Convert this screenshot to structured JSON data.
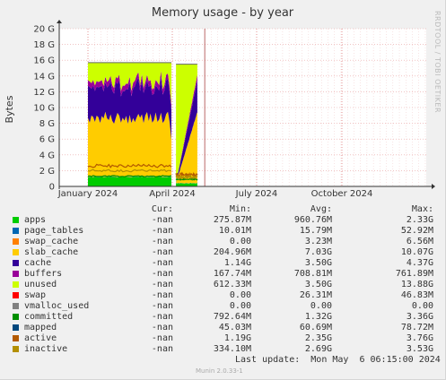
{
  "chart_data": {
    "type": "area",
    "title": "Memory usage - by year",
    "ylabel": "Bytes",
    "side_label": "RRDTOOL / TOBI OETIKER",
    "ylim": [
      0,
      20
    ],
    "y_ticks": [
      "0",
      "2 G",
      "4 G",
      "6 G",
      "8 G",
      "10 G",
      "12 G",
      "14 G",
      "16 G",
      "18 G",
      "20 G"
    ],
    "x_ticks": [
      "January 2024",
      "April 2024",
      "July 2024",
      "October 2024"
    ],
    "x_tick_months": [
      0,
      3,
      6,
      9
    ],
    "xlim": [
      "2023-12-01",
      "2024-12-31"
    ],
    "columns": {
      "cur": "Cur:",
      "min": "Min:",
      "avg": "Avg:",
      "max": "Max:"
    },
    "series": [
      {
        "name": "apps",
        "color": "#00cc00",
        "cur": "-nan",
        "min": "275.87M",
        "avg": "960.76M",
        "max": "2.33G"
      },
      {
        "name": "page_tables",
        "color": "#0066b3",
        "cur": "-nan",
        "min": "10.01M",
        "avg": "15.79M",
        "max": "52.92M"
      },
      {
        "name": "swap_cache",
        "color": "#ff8000",
        "cur": "-nan",
        "min": "0.00",
        "avg": "3.23M",
        "max": "6.56M"
      },
      {
        "name": "slab_cache",
        "color": "#ffcc00",
        "cur": "-nan",
        "min": "204.96M",
        "avg": "7.03G",
        "max": "10.07G"
      },
      {
        "name": "cache",
        "color": "#330099",
        "cur": "-nan",
        "min": "1.14G",
        "avg": "3.50G",
        "max": "4.37G"
      },
      {
        "name": "buffers",
        "color": "#990099",
        "cur": "-nan",
        "min": "167.74M",
        "avg": "708.81M",
        "max": "761.89M"
      },
      {
        "name": "unused",
        "color": "#ccff00",
        "cur": "-nan",
        "min": "612.33M",
        "avg": "3.50G",
        "max": "13.88G"
      },
      {
        "name": "swap",
        "color": "#ff0000",
        "cur": "-nan",
        "min": "0.00",
        "avg": "26.31M",
        "max": "46.83M"
      },
      {
        "name": "vmalloc_used",
        "color": "#808080",
        "cur": "-nan",
        "min": "0.00",
        "avg": "0.00",
        "max": "0.00"
      },
      {
        "name": "committed",
        "color": "#008f00",
        "cur": "-nan",
        "min": "792.64M",
        "avg": "1.32G",
        "max": "3.36G"
      },
      {
        "name": "mapped",
        "color": "#00487d",
        "cur": "-nan",
        "min": "45.03M",
        "avg": "60.69M",
        "max": "78.72M"
      },
      {
        "name": "active",
        "color": "#b35a00",
        "cur": "-nan",
        "min": "1.19G",
        "avg": "2.35G",
        "max": "3.76G"
      },
      {
        "name": "inactive",
        "color": "#b38f00",
        "cur": "-nan",
        "min": "334.10M",
        "avg": "2.69G",
        "max": "3.53G"
      }
    ],
    "segments": [
      {
        "x_start": "2024-01-01",
        "x_end": "2024-03-31",
        "apps": 1.2,
        "page_tables": 0.03,
        "swap_cache": 0.01,
        "slab_cache": 7.5,
        "cache": 4.0,
        "buffers": 0.7,
        "unused_top": 15.7,
        "active": 2.6,
        "inactive": 2.0,
        "committed": 1.3
      },
      {
        "x_start": "2024-04-05",
        "x_end": "2024-04-28",
        "apps": 0.4,
        "page_tables": 0.02,
        "swap_cache": 0.01,
        "slab_cache_end": 9.0,
        "cache_end": 4.0,
        "buffers": 0.7,
        "unused_top": 15.5,
        "active": 1.5,
        "inactive": 1.2,
        "committed": 0.9
      }
    ]
  },
  "legend": {
    "last_update": "Last update:  Mon May  6 06:15:00 2024"
  },
  "footer": {
    "version": "Munin 2.0.33-1"
  }
}
